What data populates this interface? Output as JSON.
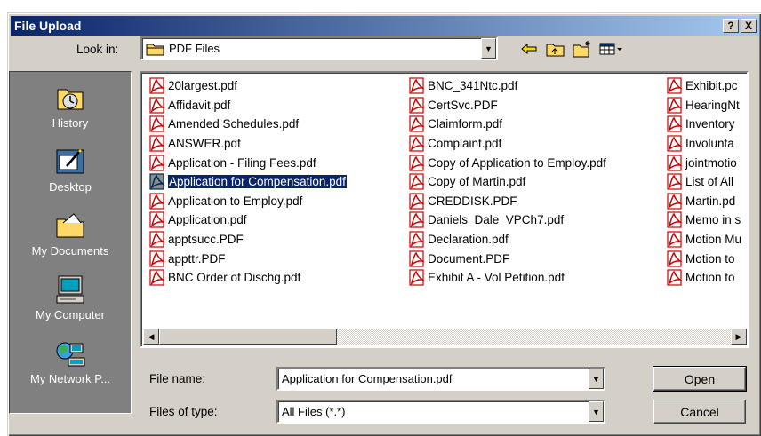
{
  "dialog": {
    "title": "File Upload",
    "help_btn": "?",
    "close_btn": "X"
  },
  "lookin": {
    "label": "Look in:",
    "value": "PDF Files"
  },
  "places": [
    {
      "label": "History"
    },
    {
      "label": "Desktop"
    },
    {
      "label": "My Documents"
    },
    {
      "label": "My Computer"
    },
    {
      "label": "My Network P..."
    }
  ],
  "files": {
    "col1": [
      "20largest.pdf",
      "Affidavit.pdf",
      "Amended Schedules.pdf",
      "ANSWER.pdf",
      "Application - Filing Fees.pdf",
      "Application for Compensation.pdf",
      "Application to Employ.pdf",
      "Application.pdf",
      "apptsucc.PDF",
      "appttr.PDF",
      "BNC Order of Dischg.pdf"
    ],
    "col2": [
      "BNC_341Ntc.pdf",
      "CertSvc.PDF",
      "Claimform.pdf",
      "Complaint.pdf",
      "Copy of Application to Employ.pdf",
      "Copy of Martin.pdf",
      "CREDDISK.PDF",
      "Daniels_Dale_VPCh7.pdf",
      "Declaration.pdf",
      "Document.PDF",
      "Exhibit A - Vol Petition.pdf"
    ],
    "col3": [
      "Exhibit.pc",
      "HearingNt",
      "Inventory",
      "Involunta",
      "jointmotio",
      "List of All",
      "Martin.pd",
      "Memo in s",
      "Motion Mu",
      "Motion to",
      "Motion to"
    ],
    "selected": "Application for Compensation.pdf"
  },
  "filename": {
    "label": "File name:",
    "value": "Application for Compensation.pdf"
  },
  "filetype": {
    "label": "Files of type:",
    "value": "All Files (*.*)"
  },
  "buttons": {
    "open": "Open",
    "cancel": "Cancel"
  },
  "colors": {
    "title_start": "#0a246a",
    "title_end": "#a6caf0",
    "face": "#d4d0c8",
    "selection": "#0a246a",
    "pdf_red": "#cc0000"
  }
}
